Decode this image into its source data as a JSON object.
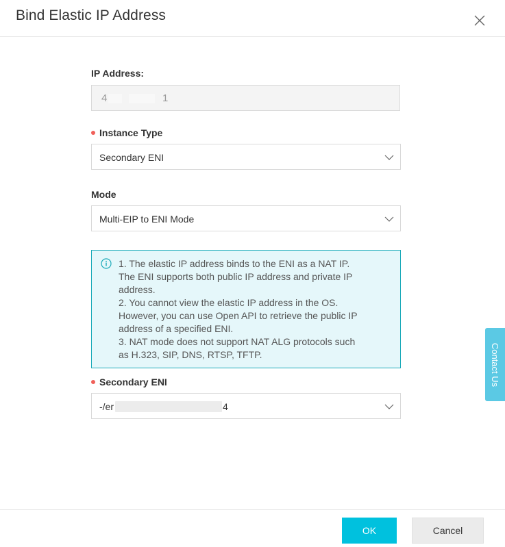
{
  "dialog": {
    "title": "Bind Elastic IP Address"
  },
  "fields": {
    "ip_address": {
      "label": "IP Address:",
      "value_start": "4",
      "value_end": "1"
    },
    "instance_type": {
      "label": "Instance Type",
      "value": "Secondary ENI"
    },
    "mode": {
      "label": "Mode",
      "value": "Multi-EIP to ENI Mode"
    },
    "secondary_eni": {
      "label": "Secondary ENI",
      "value_start": "-/er",
      "value_end": "4"
    }
  },
  "notice": {
    "lines": [
      "1. The elastic IP address binds to the ENI as a NAT IP.",
      "The ENI supports both public IP address and private IP",
      "address.",
      "2. You cannot view the elastic IP address in the OS.",
      "However, you can use Open API to retrieve the public IP",
      "address of a specified ENI.",
      "3. NAT mode does not support NAT ALG protocols such",
      "as H.323, SIP, DNS, RTSP, TFTP."
    ]
  },
  "footer": {
    "ok_label": "OK",
    "cancel_label": "Cancel"
  },
  "contact_tab": {
    "label": "Contact Us"
  },
  "colors": {
    "primary": "#00c1de",
    "required": "#f0605a",
    "notice_border": "#19a9b8",
    "notice_bg": "#e5f7fa",
    "contact_tab": "#5bc9e4"
  }
}
